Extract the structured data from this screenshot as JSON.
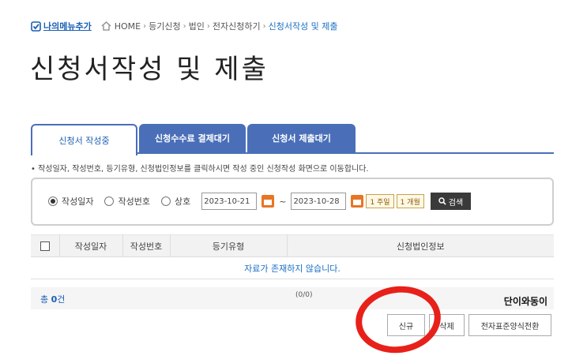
{
  "topbar": {
    "my_menu": "나의메뉴추가",
    "breadcrumb": [
      {
        "label": "HOME"
      },
      {
        "label": "등기신청"
      },
      {
        "label": "법인"
      },
      {
        "label": "전자신청하기"
      },
      {
        "label": "신청서작성 및 제출"
      }
    ]
  },
  "page": {
    "title": "신청서작성 및 제출"
  },
  "tabs": [
    {
      "label": "신청서 작성중",
      "active": true
    },
    {
      "label": "신청수수료 결제대기"
    },
    {
      "label": "신청서 제출대기"
    }
  ],
  "notice": "• 작성일자, 작성번호, 등기유형, 신청법인정보를 클릭하시면 작성 중인 신청작성 화면으로 이동합니다.",
  "search": {
    "options": [
      {
        "label": "작성일자",
        "selected": true
      },
      {
        "label": "작성번호"
      },
      {
        "label": "상호"
      }
    ],
    "date_from": "2023-10-21",
    "date_to": "2023-10-28",
    "tilde": "~",
    "quick_week": "1 주일",
    "quick_month": "1 개월",
    "search_label": "검색"
  },
  "table": {
    "headers": [
      "작성일자",
      "작성번호",
      "등기유형",
      "신청법인정보"
    ],
    "empty_message": "자료가 존재하지 않습니다."
  },
  "footer": {
    "total_prefix": "총 ",
    "total_count": "0",
    "total_suffix": "건",
    "paging": "(0/0)",
    "watermark": "단이와동이"
  },
  "actions": {
    "new_label": "신규",
    "delete_label": "삭제",
    "convert_label": "전자표준양식전환"
  },
  "colors": {
    "tab_blue": "#4a6fb8",
    "link_blue": "#1a6fc4",
    "highlight_red": "#e8201a"
  }
}
